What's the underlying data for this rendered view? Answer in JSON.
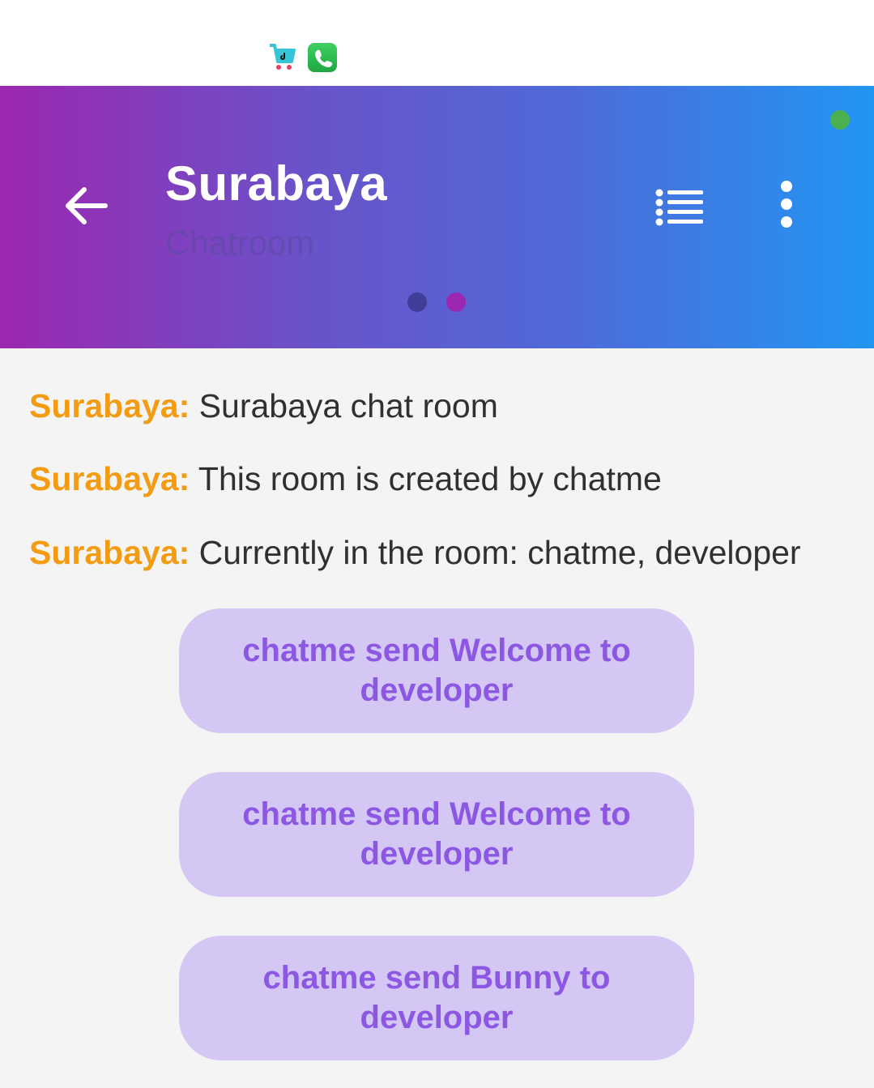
{
  "header": {
    "title": "Surabaya",
    "subtitle": "Chatroom"
  },
  "messages": [
    {
      "sender": "Surabaya:",
      "text": "Surabaya chat room"
    },
    {
      "sender": "Surabaya:",
      "text": "This room is created by chatme"
    },
    {
      "sender": "Surabaya:",
      "text": "Currently in the room: chatme, developer"
    }
  ],
  "gifts": [
    {
      "label": "chatme send Welcome to developer"
    },
    {
      "label": "chatme send Welcome to developer"
    },
    {
      "label": "chatme send Bunny to developer"
    }
  ],
  "icons": {
    "back": "back-arrow-icon",
    "list": "list-icon",
    "more": "more-vertical-icon",
    "status_app_1": "shopping-cart-icon",
    "status_app_2": "phone-icon"
  },
  "colors": {
    "header_gradient_start": "#9c27b0",
    "header_gradient_end": "#2196f3",
    "sender_color": "#f39c12",
    "gift_bubble": "#d4c7f4",
    "gift_text": "#8b57e3",
    "online_indicator": "#4caf50"
  },
  "pager": {
    "pages": 2,
    "active": 2
  }
}
